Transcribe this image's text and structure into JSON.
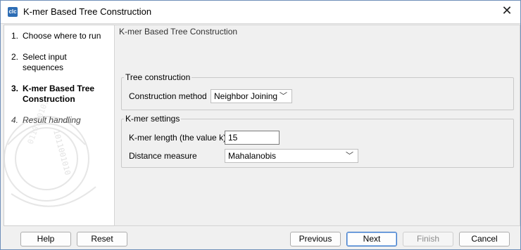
{
  "window": {
    "title": "K-mer Based Tree Construction",
    "app_icon_text": "clc"
  },
  "steps": [
    {
      "num": "1.",
      "label": "Choose where to run"
    },
    {
      "num": "2.",
      "label": "Select input sequences"
    },
    {
      "num": "3.",
      "label": "K-mer Based Tree Construction"
    },
    {
      "num": "4.",
      "label": "Result handling"
    }
  ],
  "panel": {
    "header": "K-mer Based Tree Construction",
    "tree_group": {
      "legend": "Tree construction",
      "method_label": "Construction method",
      "method_value": "Neighbor Joining"
    },
    "kmer_group": {
      "legend": "K-mer settings",
      "length_label": "K-mer length (the value k)",
      "length_value": "15",
      "distance_label": "Distance measure",
      "distance_value": "Mahalanobis"
    }
  },
  "buttons": {
    "help": "Help",
    "reset": "Reset",
    "previous": "Previous",
    "next": "Next",
    "finish": "Finish",
    "cancel": "Cancel"
  }
}
